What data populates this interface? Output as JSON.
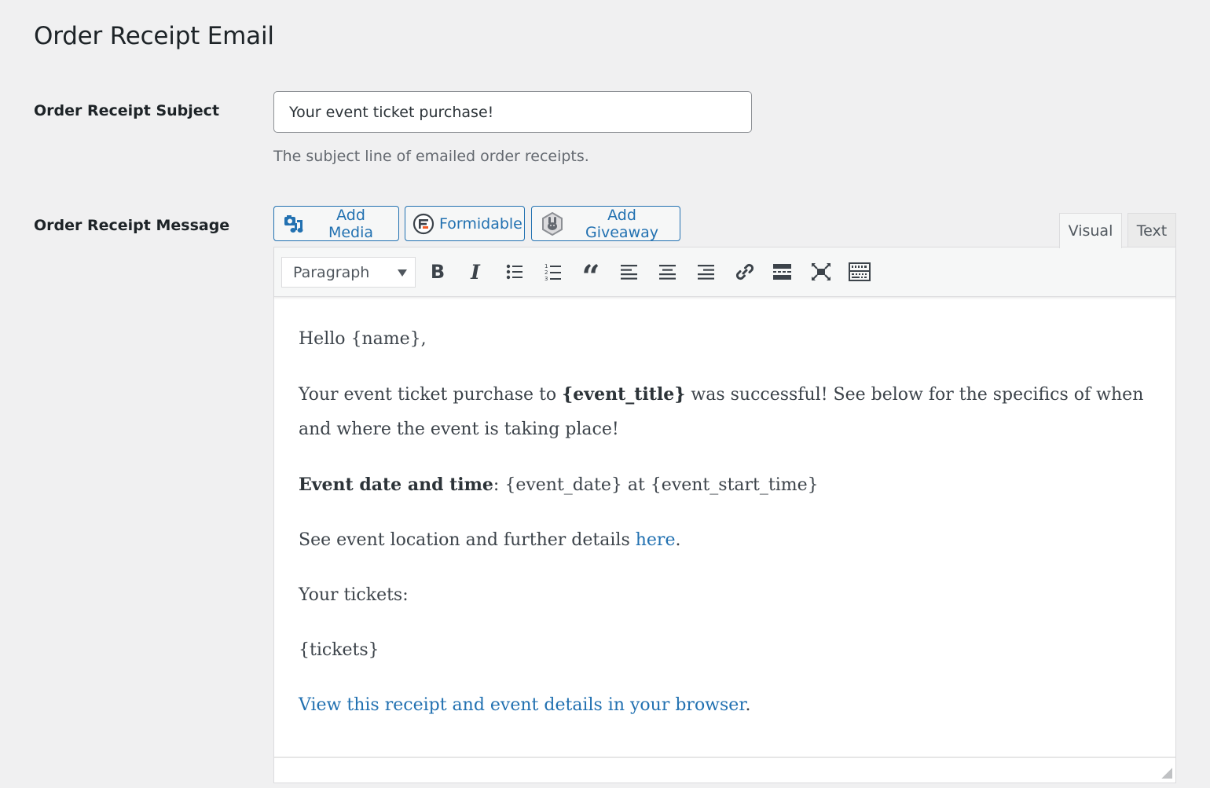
{
  "page": {
    "title": "Order Receipt Email"
  },
  "subject": {
    "label": "Order Receipt Subject",
    "value": "Your event ticket purchase!",
    "description": "The subject line of emailed order receipts."
  },
  "message": {
    "label": "Order Receipt Message",
    "media_buttons": [
      {
        "label": "Add Media",
        "icon": "add-media-icon"
      },
      {
        "label": "Formidable",
        "icon": "formidable-icon"
      },
      {
        "label": "Add Giveaway",
        "icon": "giveaway-icon"
      }
    ],
    "tabs": [
      {
        "label": "Visual",
        "active": true
      },
      {
        "label": "Text",
        "active": false
      }
    ],
    "toolbar": {
      "format_select": "Paragraph",
      "buttons": [
        {
          "name": "bold",
          "icon": "bold-icon"
        },
        {
          "name": "italic",
          "icon": "italic-icon"
        },
        {
          "name": "bulleted-list",
          "icon": "bullet-list-icon"
        },
        {
          "name": "numbered-list",
          "icon": "numbered-list-icon"
        },
        {
          "name": "blockquote",
          "icon": "blockquote-icon"
        },
        {
          "name": "align-left",
          "icon": "align-left-icon"
        },
        {
          "name": "align-center",
          "icon": "align-center-icon"
        },
        {
          "name": "align-right",
          "icon": "align-right-icon"
        },
        {
          "name": "insert-link",
          "icon": "link-icon"
        },
        {
          "name": "read-more",
          "icon": "read-more-icon"
        },
        {
          "name": "fullscreen",
          "icon": "fullscreen-icon"
        },
        {
          "name": "toolbar-toggle",
          "icon": "keyboard-icon"
        }
      ]
    },
    "content": {
      "greeting": "Hello {name},",
      "p1_before": "Your event ticket purchase to ",
      "p1_bold": "{event_title}",
      "p1_after": " was successful! See below for the specifics of when and where the event is taking place!",
      "p2_bold": "Event date and time",
      "p2_after": ": {event_date} at {event_start_time}",
      "p3_before": "See event location and further details ",
      "p3_link": "here",
      "p3_after": ".",
      "p4": "Your tickets:",
      "p5": "{tickets}",
      "p6_link": "View this receipt and event details in your browser",
      "p6_after": "."
    }
  },
  "colors": {
    "accent": "#2271b1",
    "background": "#f0f0f1",
    "formidable_red": "#f15a24"
  }
}
